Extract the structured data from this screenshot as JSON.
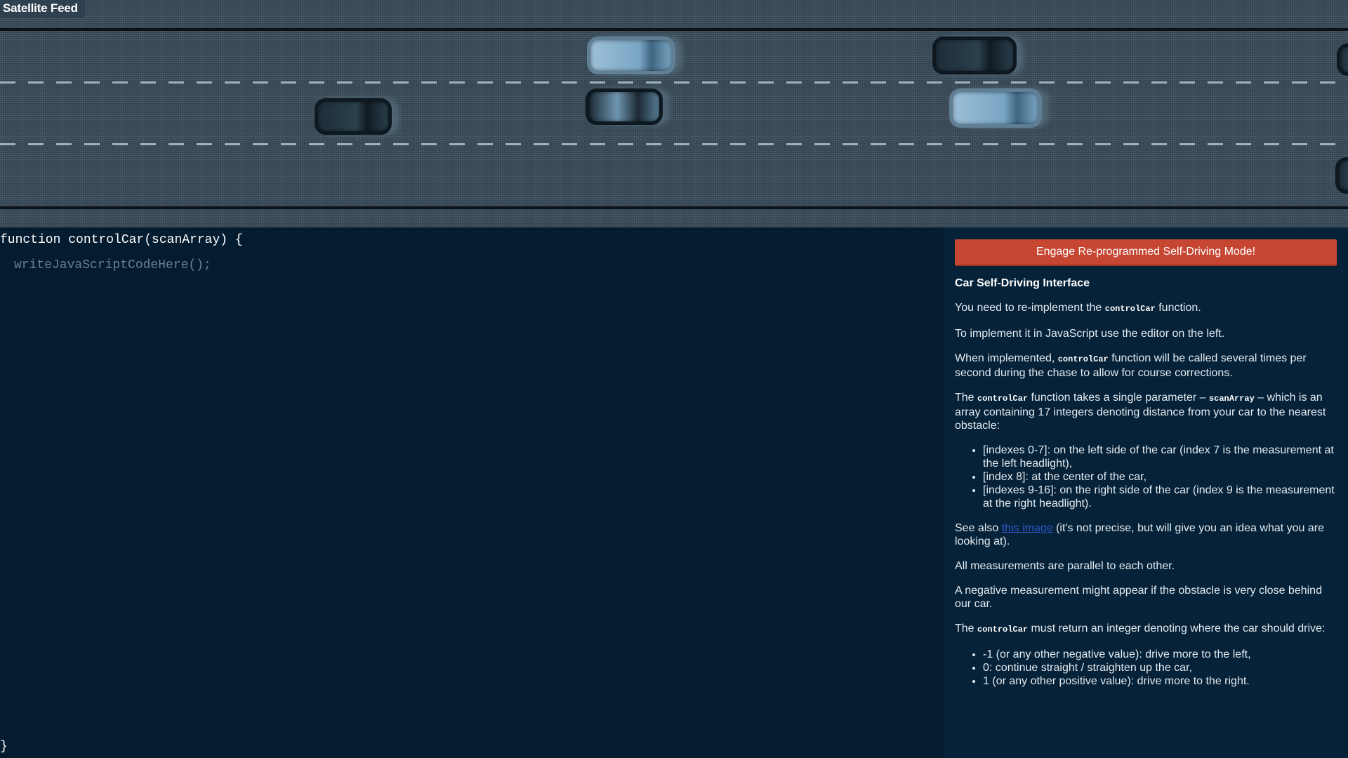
{
  "feed": {
    "title": "Satellite Feed"
  },
  "editor": {
    "header": "function controlCar(scanArray) {",
    "body": "writeJavaScriptCodeHere();",
    "footer": "}"
  },
  "panel": {
    "engage_label": "Engage Re-programmed Self-Driving Mode!",
    "title": "Car Self-Driving Interface",
    "p1": {
      "a": "You need to re-implement the ",
      "code": "controlCar",
      "b": " function."
    },
    "p2": "To implement it in JavaScript use the editor on the left.",
    "p3": {
      "a": "When implemented, ",
      "code": "controlCar",
      "b": " function will be called several times per second during the chase to allow for course corrections."
    },
    "p4": {
      "a": "The ",
      "code1": "controlCar",
      "b": " function takes a single parameter – ",
      "code2": "scanArray",
      "c": " – which is an array containing 17 integers denoting distance from your car to the nearest obstacle:"
    },
    "scan_list": [
      "[indexes 0-7]: on the left side of the car (index 7 is the measurement at the left headlight),",
      "[index 8]: at the center of the car,",
      "[indexes 9-16]: on the right side of the car (index 9 is the measurement at the right headlight)."
    ],
    "p5": {
      "a": "See also ",
      "link": "this image",
      "b": " (it's not precise, but will give you an idea what you are looking at)."
    },
    "p6": "All measurements are parallel to each other.",
    "p7": "A negative measurement might appear if the obstacle is very close behind our car.",
    "p8": {
      "a": "The ",
      "code": "controlCar",
      "b": " must return an integer denoting where the car should drive:"
    },
    "return_list": [
      "-1 (or any other negative value): drive more to the left,",
      "0: continue straight / straighten up the car,",
      "1 (or any other positive value): drive more to the right."
    ],
    "colors": {
      "button": "#c74632",
      "panel_bg": "#052238",
      "editor_bg": "#041c30",
      "link": "#2f56c4"
    }
  }
}
